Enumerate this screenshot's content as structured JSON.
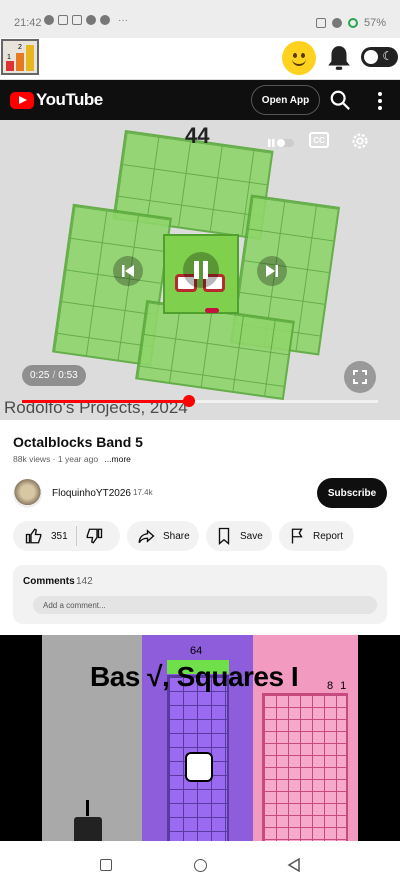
{
  "status_bar": {
    "time": "21:42",
    "battery": "57%",
    "icons": [
      "whatsapp-icon",
      "mute-icon",
      "download-icon",
      "cloud-icon",
      "messenger-icon",
      "more-dots-icon",
      "signal-icon",
      "wifi-icon",
      "battery-icon"
    ]
  },
  "app_bar": {
    "icons": [
      "app-logo",
      "smiley-icon",
      "bell-icon",
      "dark-mode-toggle"
    ],
    "logo_digits": [
      "1",
      "2"
    ],
    "accent": "#ffd21f"
  },
  "youtube_bar": {
    "brand": "YouTube",
    "open_app_label": "Open App",
    "icons": [
      "search-icon",
      "more-vert-icon"
    ],
    "brand_color": "#ff0000"
  },
  "video": {
    "overlay_count": "44",
    "watermark": "Rodolfo's Projects, 2024",
    "current_time": "0:25",
    "time_separator": "/",
    "duration": "0:53",
    "progress_fraction": 0.47,
    "controls": [
      "autoplay-toggle-icon",
      "captions-icon",
      "settings-gear-icon",
      "previous-icon",
      "pause-icon",
      "next-icon",
      "fullscreen-icon"
    ],
    "captions_label": "CC"
  },
  "details": {
    "title": "Octalblocks Band 5",
    "meta": "88k views · 1 year ago",
    "more_label": "...more",
    "channel_name": "FloquinhoYT2026",
    "subscribers": "17.4k",
    "subscribe_label": "Subscribe"
  },
  "actions": {
    "likes": "351",
    "share": "Share",
    "save": "Save",
    "report": "Report"
  },
  "comments": {
    "heading": "Comments",
    "count": "142",
    "placeholder": "Add a comment..."
  },
  "next_video": {
    "title": "Bas √, Squares I",
    "number_left": "64",
    "number_right": "8 1"
  },
  "nav_bar": {
    "icons": [
      "recent-apps-icon",
      "home-icon",
      "back-icon"
    ]
  }
}
